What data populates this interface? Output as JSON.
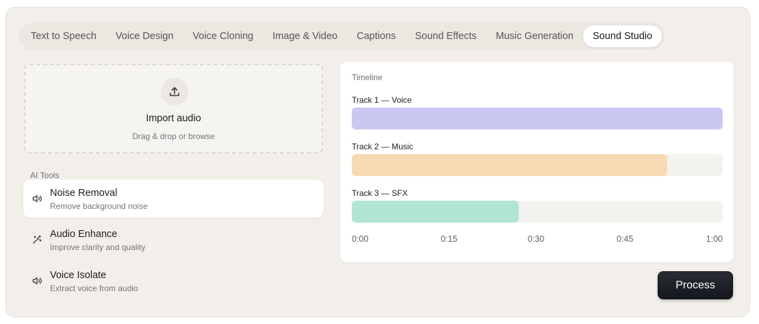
{
  "tabs": [
    {
      "label": "Text to Speech",
      "active": false
    },
    {
      "label": "Voice Design",
      "active": false
    },
    {
      "label": "Voice Cloning",
      "active": false
    },
    {
      "label": "Image & Video",
      "active": false
    },
    {
      "label": "Captions",
      "active": false
    },
    {
      "label": "Sound Effects",
      "active": false
    },
    {
      "label": "Music Generation",
      "active": false
    },
    {
      "label": "Sound Studio",
      "active": true
    }
  ],
  "import": {
    "icon": "upload-icon",
    "title": "Import audio",
    "subtitle": "Drag & drop or browse"
  },
  "ai_tools": {
    "label": "AI Tools",
    "items": [
      {
        "icon": "speaker-icon",
        "name": "Noise Removal",
        "description": "Remove background noise",
        "selected": true
      },
      {
        "icon": "magic-wand-icon",
        "name": "Audio Enhance",
        "description": "Improve clarity and quality",
        "selected": false
      },
      {
        "icon": "speaker-icon",
        "name": "Voice Isolate",
        "description": "Extract voice from audio",
        "selected": false
      }
    ]
  },
  "timeline": {
    "label": "Timeline",
    "tracks": [
      {
        "name": "Track 1 — Voice",
        "fill": 1.0,
        "color": "#c9c8f3"
      },
      {
        "name": "Track 2 — Music",
        "fill": 0.85,
        "color": "#f6dbb2"
      },
      {
        "name": "Track 3 — SFX",
        "fill": 0.45,
        "color": "#b2e5d5"
      }
    ],
    "ticks": [
      "0:00",
      "0:15",
      "0:30",
      "0:45",
      "1:00"
    ]
  },
  "process_label": "Process"
}
